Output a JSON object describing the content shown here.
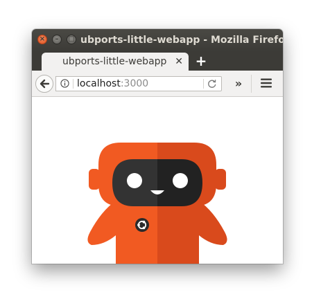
{
  "window": {
    "title": "ubports-little-webapp - Mozilla Firefox",
    "controls": [
      "close-icon",
      "minimize-icon",
      "maximize-icon"
    ]
  },
  "tabs": [
    {
      "label": "ubports-little-webapp",
      "active": true,
      "close_icon": "close-icon"
    }
  ],
  "new_tab_icon": "plus-icon",
  "navbar": {
    "back_icon": "back-arrow-icon",
    "info_icon": "info-icon",
    "url": {
      "host": "localhost",
      "port": ":3000"
    },
    "reload_icon": "reload-icon",
    "overflow_icon": "chevron-double-right-icon",
    "menu_icon": "hamburger-menu-icon"
  },
  "content": {
    "image": "ubports-robot-mascot",
    "colors": {
      "orange": "#f15a22",
      "orange_dark": "#d94a1c",
      "face": "#333333",
      "eyes": "#ffffff"
    }
  }
}
